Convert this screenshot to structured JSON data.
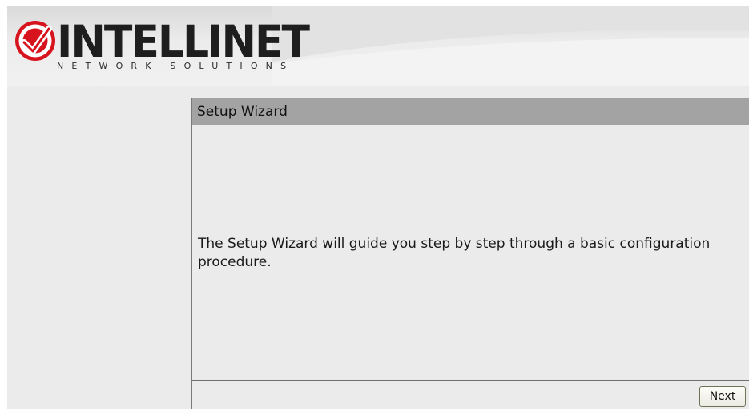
{
  "header": {
    "logo_text": "INTELLINET",
    "logo_subtitle": "NETWORK SOLUTIONS",
    "logo_icon": "check-mark-circle-icon"
  },
  "panel": {
    "title": "Setup Wizard",
    "description": "The Setup Wizard will guide you step by step through a basic configuration procedure.",
    "next_label": "Next"
  },
  "colors": {
    "brand_red": "#d7141e",
    "title_bar": "#a3a3a3",
    "background": "#ebebeb"
  }
}
